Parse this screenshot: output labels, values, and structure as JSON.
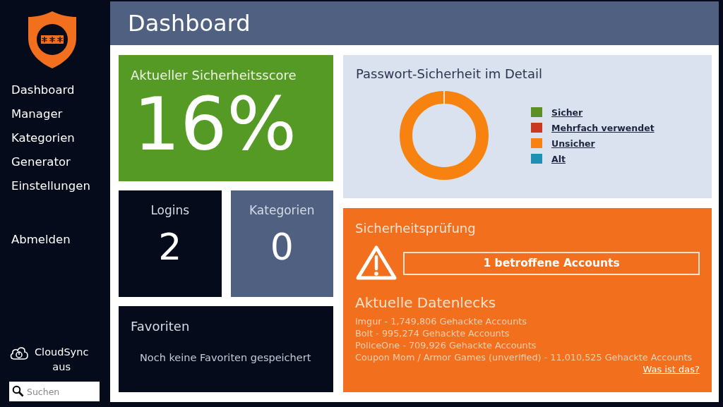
{
  "sidebar": {
    "nav": [
      {
        "label": "Dashboard"
      },
      {
        "label": "Manager"
      },
      {
        "label": "Kategorien"
      },
      {
        "label": "Generator"
      },
      {
        "label": "Einstellungen"
      }
    ],
    "logout": "Abmelden",
    "cloudsync": {
      "label": "CloudSync",
      "status": "aus"
    },
    "search": {
      "placeholder": "Suchen"
    }
  },
  "header": {
    "title": "Dashboard"
  },
  "score": {
    "title": "Aktueller Sicherheitsscore",
    "value": "16%"
  },
  "stats": [
    {
      "label": "Logins",
      "value": "2"
    },
    {
      "label": "Kategorien",
      "value": "0"
    }
  ],
  "favorites": {
    "title": "Favoriten",
    "empty": "Noch keine Favoriten gespeichert"
  },
  "detail": {
    "title": "Passwort-Sicherheit im Detail",
    "legend": [
      {
        "label": "Sicher",
        "color": "#5e8f22"
      },
      {
        "label": "Mehrfach verwendet",
        "color": "#c9391f"
      },
      {
        "label": "Unsicher",
        "color": "#f7820f"
      },
      {
        "label": "Alt",
        "color": "#1f8fb4"
      }
    ]
  },
  "audit": {
    "title": "Sicherheitsprüfung",
    "affected": "1 betroffene Accounts",
    "breaches_title": "Aktuelle Datenlecks",
    "breaches": [
      "imgur - 1,749,806 Gehackte Accounts",
      "Bolt - 995,274 Gehackte Accounts",
      "PoliceOne - 709,926 Gehackte Accounts",
      "Coupon Mom / Armor Games (unverified) - 11,010,525 Gehackte Accounts"
    ],
    "link": "Was ist das?"
  }
}
